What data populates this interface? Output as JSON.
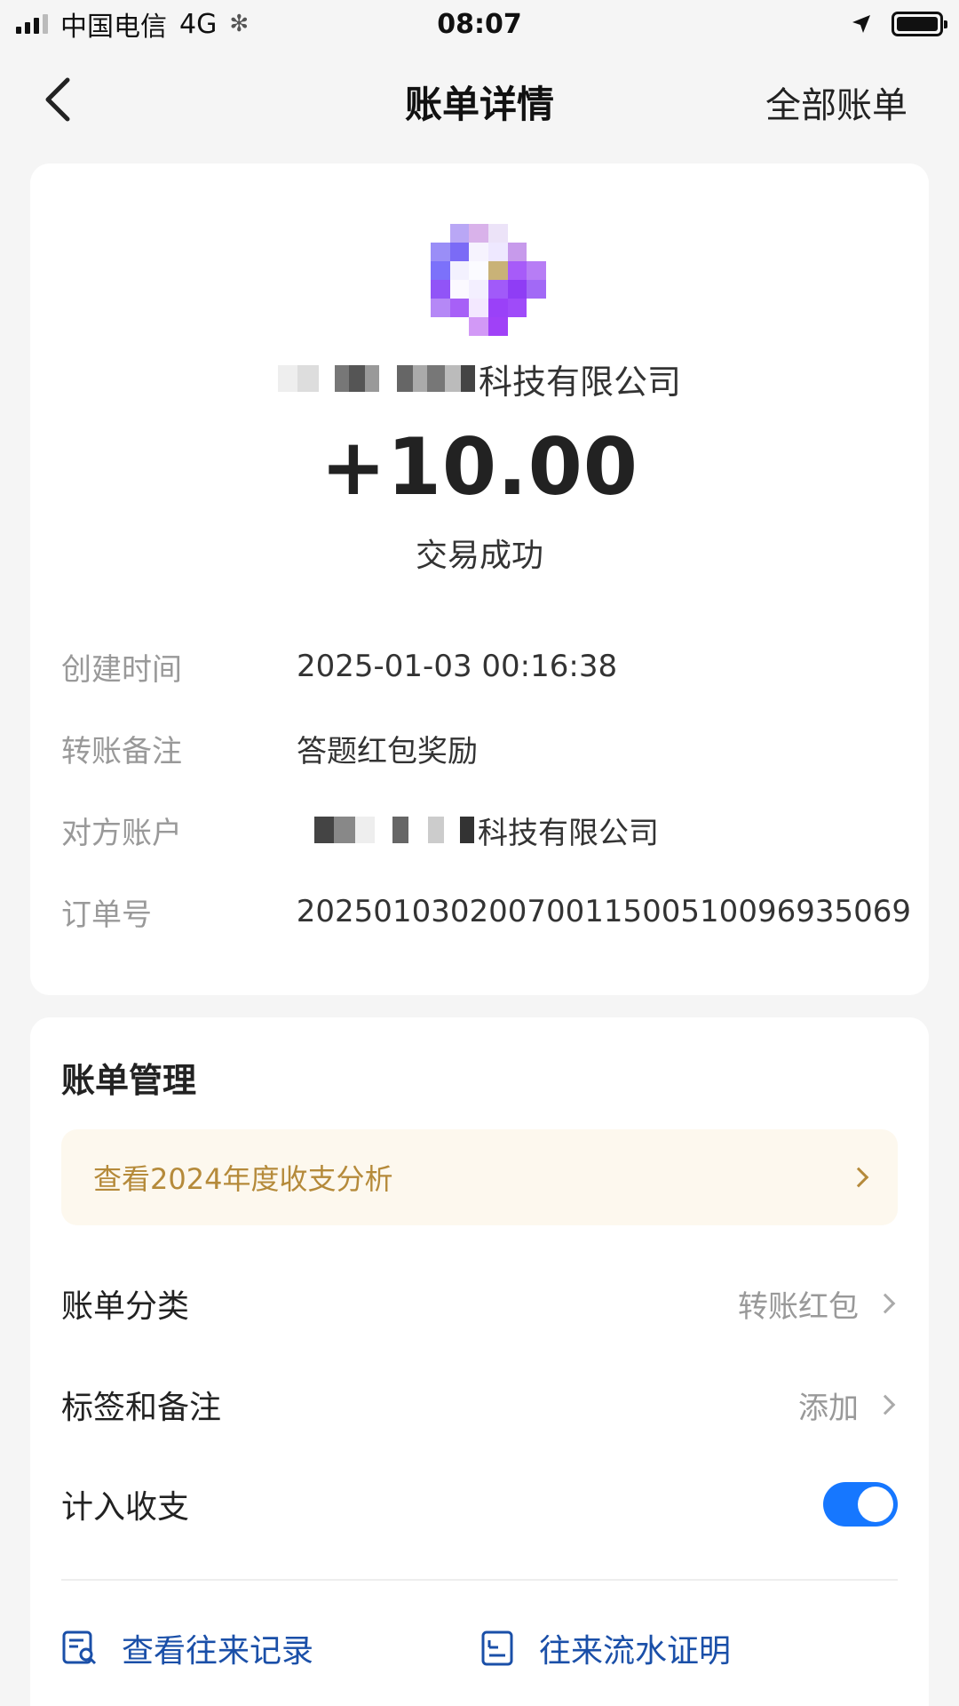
{
  "status_bar": {
    "carrier": "中国电信",
    "network": "4G",
    "time": "08:07"
  },
  "nav": {
    "back_icon": "chevron-left-icon",
    "title": "账单详情",
    "right_label": "全部账单"
  },
  "transaction": {
    "merchant_suffix": "科技有限公司",
    "amount": "+10.00",
    "status": "交易成功",
    "details": [
      {
        "label": "创建时间",
        "value": "2025-01-03 00:16:38"
      },
      {
        "label": "转账备注",
        "value": "答题红包奖励"
      },
      {
        "label": "对方账户",
        "value": "科技有限公司"
      },
      {
        "label": "订单号",
        "value": "2025010302007001150051009693 5069"
      }
    ]
  },
  "manage": {
    "title": "账单管理",
    "promo_text": "查看2024年度收支分析",
    "category_label": "账单分类",
    "category_value": "转账红包",
    "tags_label": "标签和备注",
    "tags_value": "添加",
    "include_label": "计入收支",
    "include_on": true,
    "action_history": "查看往来记录",
    "action_proof": "往来流水证明"
  },
  "colors": {
    "accent": "#1677ff",
    "promo_text": "#b58a3a",
    "action_text": "#1a4fa8"
  }
}
